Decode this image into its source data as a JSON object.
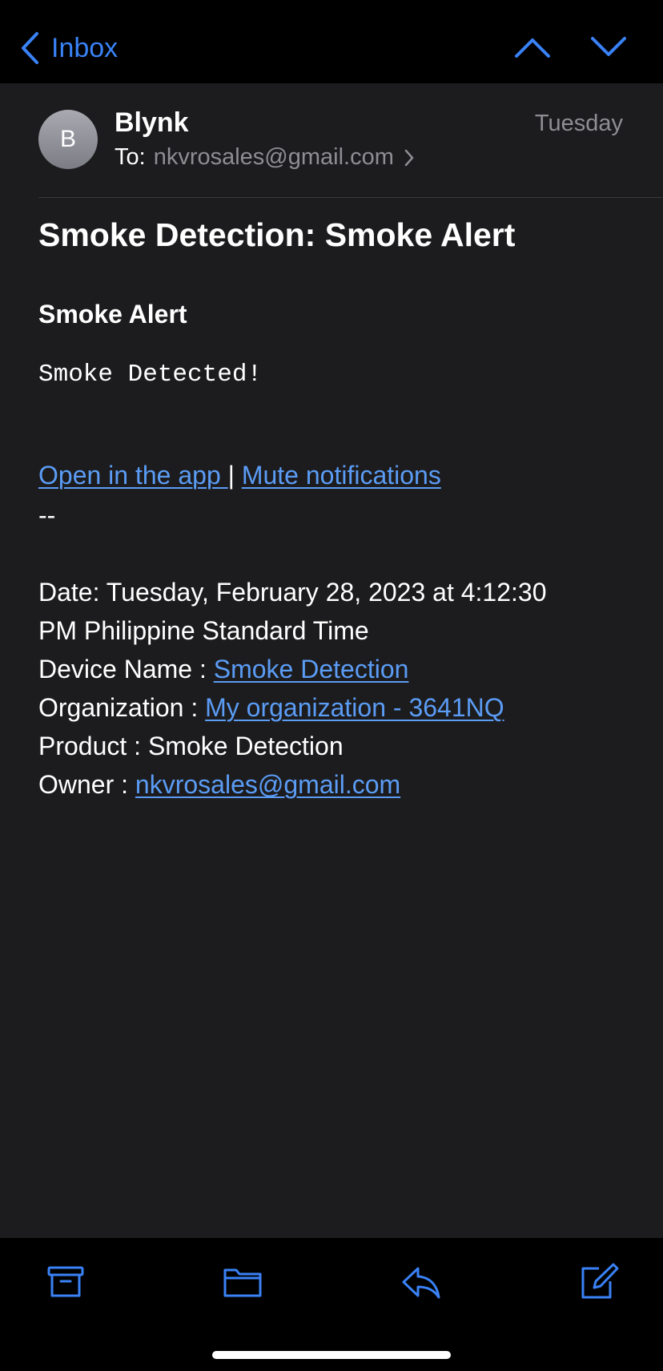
{
  "nav": {
    "back_label": "Inbox"
  },
  "message": {
    "avatar_initial": "B",
    "sender": "Blynk",
    "to_label": "To:",
    "to_address": "nkvrosales@gmail.com",
    "date": "Tuesday",
    "subject": "Smoke Detection: Smoke Alert",
    "heading": "Smoke Alert",
    "body_text": "Smoke Detected!",
    "open_app_link": "Open in the app ",
    "separator": "|",
    "mute_link": "Mute notifications ",
    "dashes": "--",
    "details": {
      "date_line_1": "Date: Tuesday, February 28, 2023 at 4:12:30",
      "date_line_2": "PM Philippine Standard Time",
      "device_label": "Device Name : ",
      "device_value": "Smoke Detection",
      "org_label": "Organization : ",
      "org_value": "My organization - 3641NQ",
      "product_line": "Product : Smoke Detection",
      "owner_label": "Owner : ",
      "owner_value": "nkvrosales@gmail.com"
    }
  },
  "toolbar": {
    "icons": [
      "archive-icon",
      "folder-icon",
      "reply-icon",
      "compose-icon"
    ]
  },
  "colors": {
    "accent": "#3a82f7",
    "link": "#5b9cf5",
    "background": "#1c1c1e",
    "bar": "#000000",
    "secondary_text": "#8e8e93"
  }
}
